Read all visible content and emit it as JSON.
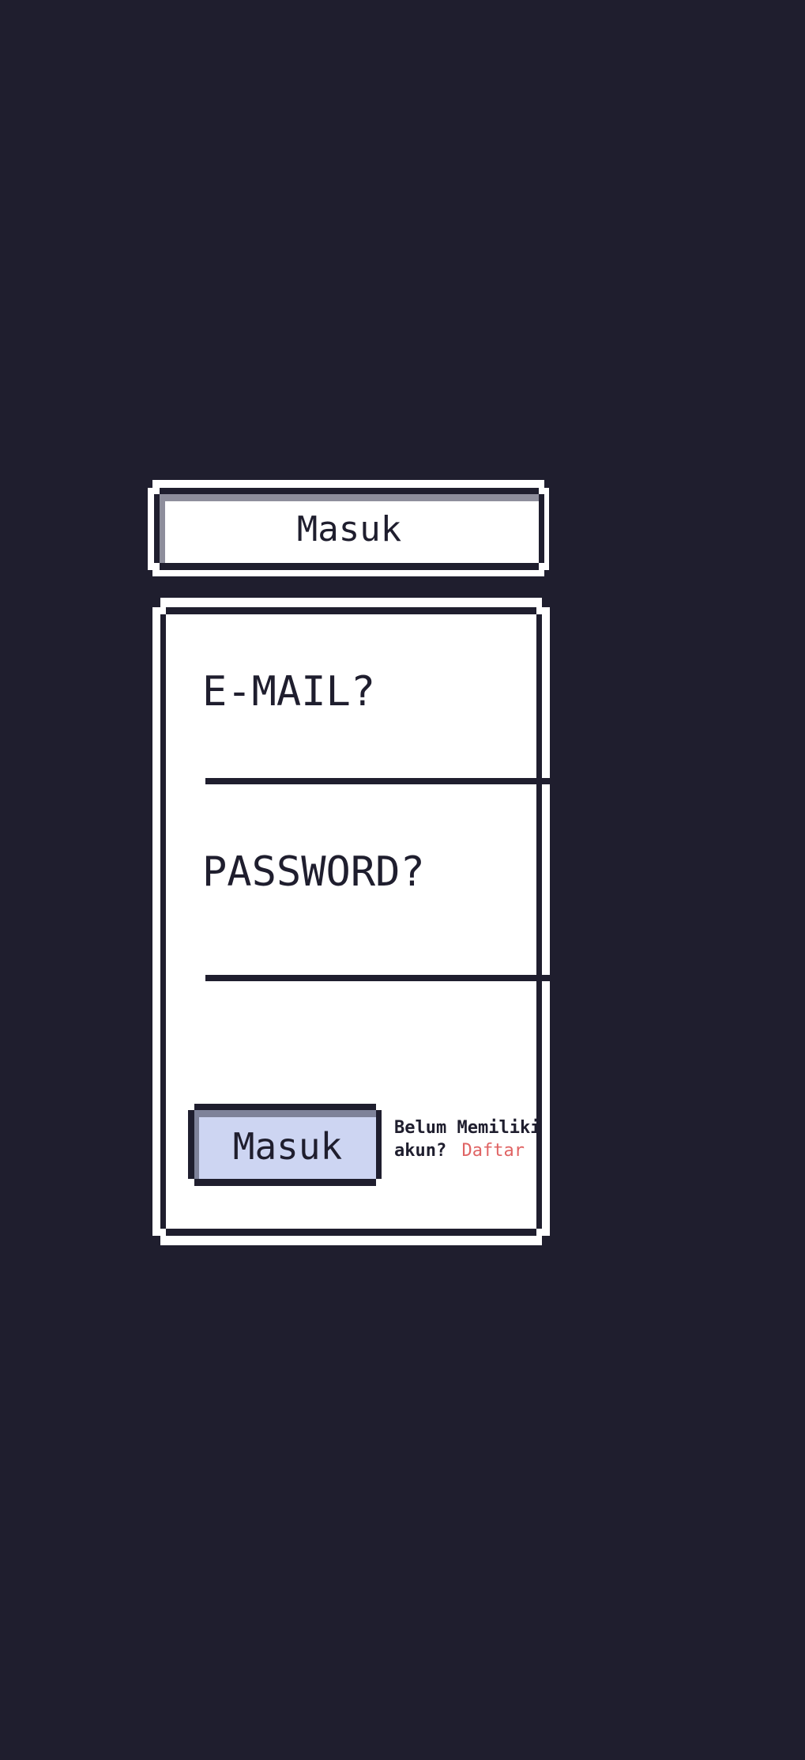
{
  "header": {
    "title": "Masuk"
  },
  "form": {
    "email_label": "E-MAIL?",
    "email_value": "",
    "password_label": "PASSWORD?",
    "password_value": "",
    "submit_label": "Masuk",
    "register_prompt_line1": "Belum Memiliki",
    "register_prompt_line2": "akun?",
    "register_link": "Daftar"
  },
  "colors": {
    "background": "#1f1e2e",
    "button_fill": "#cdd5f2",
    "link": "#e06464"
  }
}
